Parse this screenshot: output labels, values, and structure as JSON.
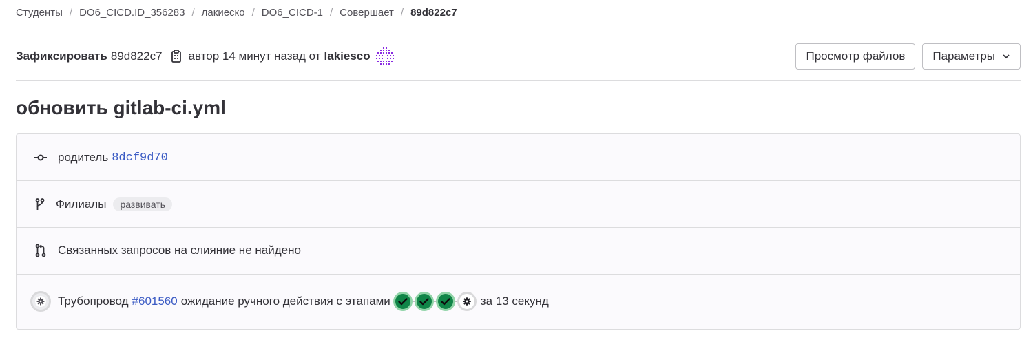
{
  "breadcrumb": {
    "items": [
      "Студенты",
      "DO6_CICD.ID_356283",
      "лакиеско",
      "DO6_CICD-1",
      "Совершает"
    ],
    "current": "89d822c7"
  },
  "commit_header": {
    "label": "Зафиксировать",
    "sha": "89d822c7",
    "authored_text": "автор 14 минут назад от",
    "author": "lakiesco",
    "browse_files_label": "Просмотр файлов",
    "options_label": "Параметры"
  },
  "commit_title": "обновить gitlab-ci.yml",
  "info": {
    "parent_label": "родитель",
    "parent_sha": "8dcf9d70",
    "branches_label": "Филиалы",
    "branch_badge": "развивать",
    "mr_text": "Связанных запросов на слияние не найдено",
    "pipeline_label": "Трубопровод",
    "pipeline_id": "#601560",
    "pipeline_status_text": "ожидание ручного действия с этапами",
    "pipeline_duration": "за 13 секунд",
    "stages": [
      "passed",
      "passed",
      "passed",
      "manual"
    ]
  },
  "colors": {
    "link": "#3b5bc4",
    "success": "#108548",
    "success_ring": "#91d4a8",
    "manual_ring": "#d9d9db",
    "avatar": "#8a2be2"
  }
}
